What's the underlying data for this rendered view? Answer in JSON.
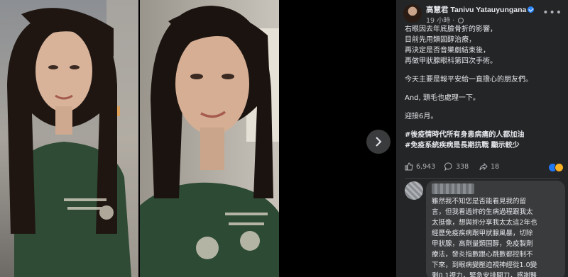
{
  "post": {
    "author": "高慧君 Tanivu Yatauyungana",
    "time": "19 小時",
    "body_lines": [
      "右眼因去年底臉骨折的影響，",
      "目前先用類固醇治療，",
      "再決定是否音樂劇結束後，",
      "再做甲狀腺眼科第四次手術。",
      "",
      "今天主要是報平安給一直擔心的朋友們。",
      "",
      "And, 頭毛也處理一下。",
      "",
      "迎接6月。",
      ""
    ],
    "tag1": "#後疫情時代所有身患病痛的人都加油",
    "tag2": "#免疫系統疾病是長期抗戰",
    "see_less": "顯示較少",
    "likes": "6,943",
    "comments": "338",
    "shares": "18"
  },
  "comment": {
    "lines": [
      "雖然我不知您是否能看見我的留",
      "言，但我看過妳的生病過程跟我太",
      "太挺像，想與妳分享我太太這2年也",
      "經歷免疫疾病跟甲狀腺風暴，切除",
      "甲狀腺，高劑量類固醇，免疫製劑",
      "療法，發炎指數跟心跳數都控制不",
      "下來，到眼病變壓迫視神經從1.0變",
      "剩0.1視力，緊急安排開刀，感謝醫"
    ]
  },
  "colors": {
    "panel_bg": "#242526",
    "text": "#e4e6eb",
    "muted": "#b0b3b8",
    "bubble": "#3a3b3c",
    "verified": "#2d88ff"
  }
}
